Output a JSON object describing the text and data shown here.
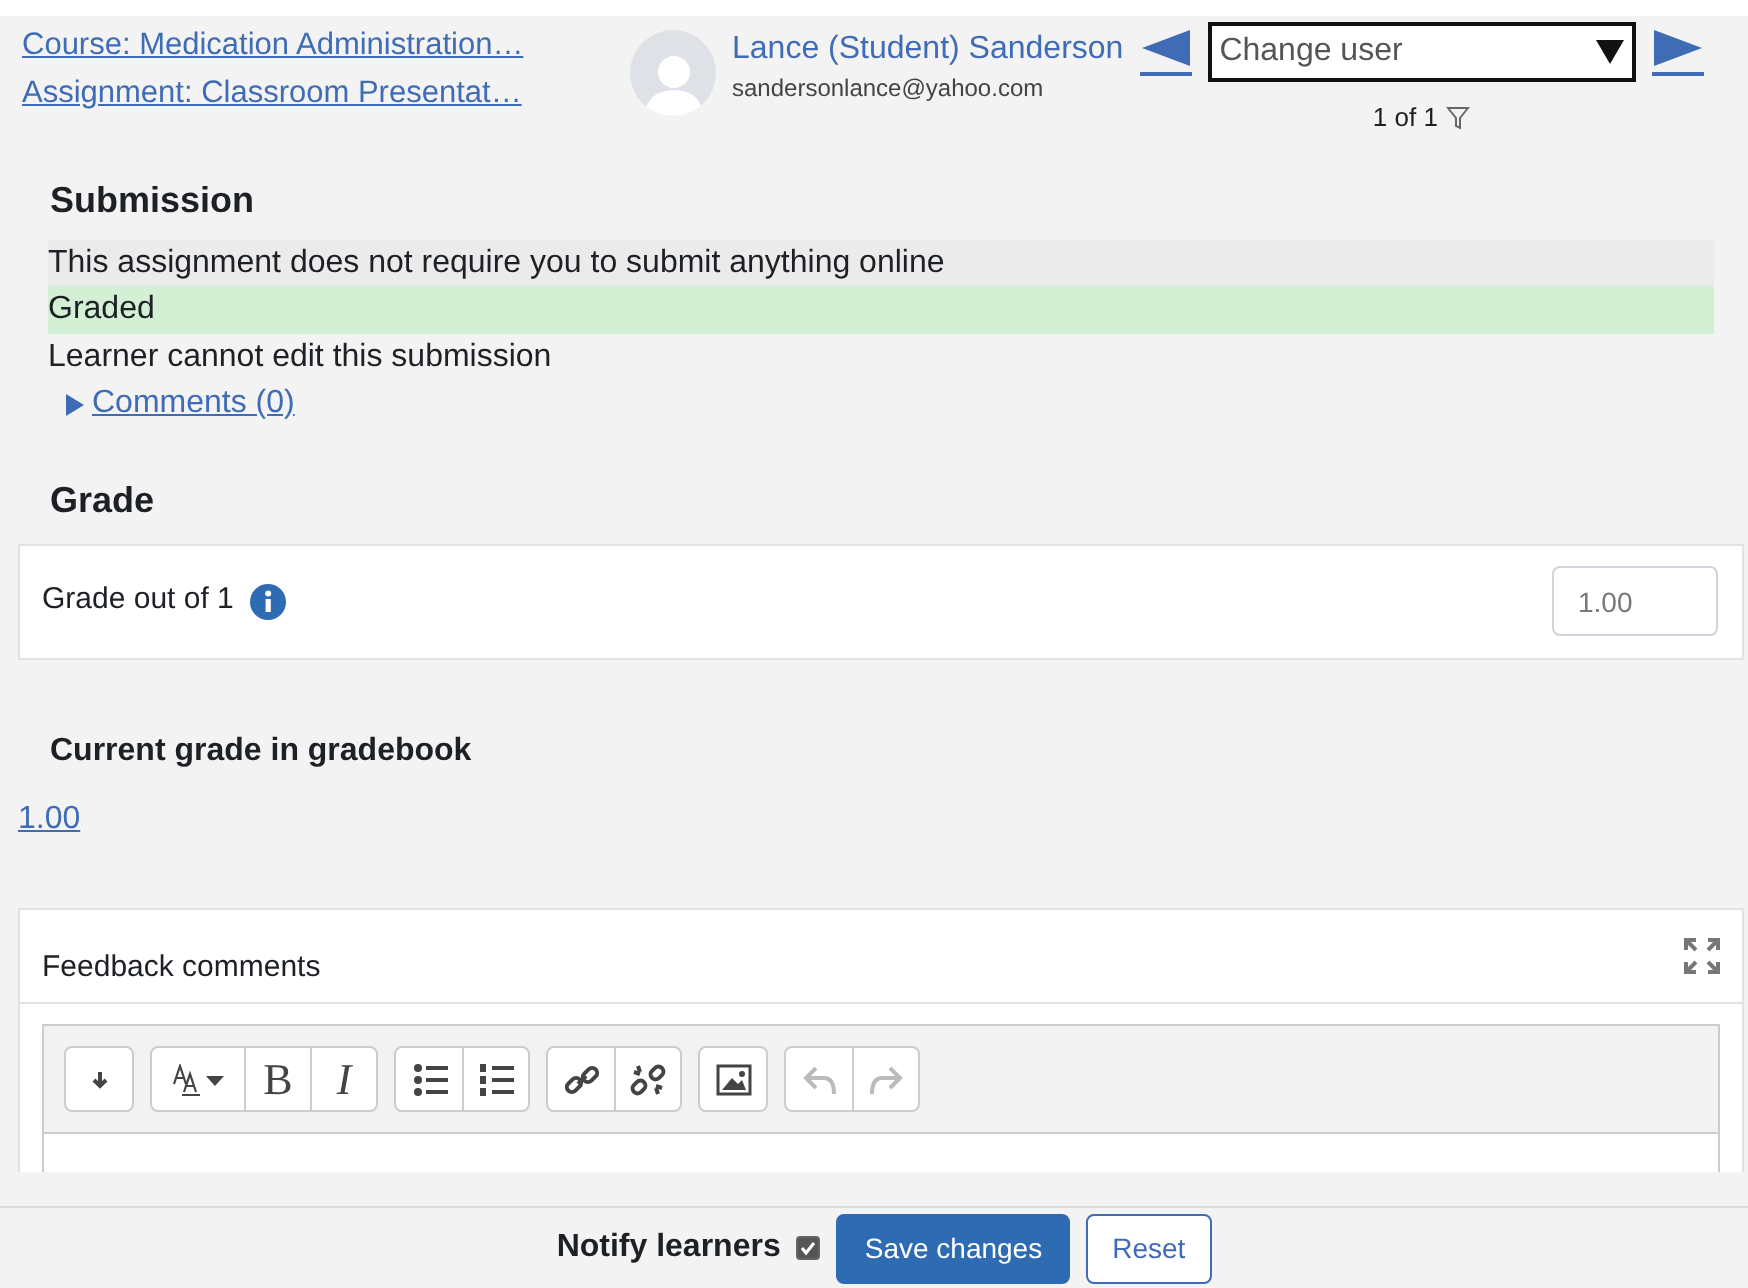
{
  "header": {
    "course_link": "Course: Medication Administration…",
    "assignment_link": "Assignment: Classroom Presentat…",
    "user": {
      "name": "Lance (Student) Sanderson",
      "email": "sandersonlance@yahoo.com"
    },
    "change_user": {
      "placeholder": "Change user"
    },
    "pager": "1 of 1"
  },
  "submission": {
    "title": "Submission",
    "statuses": [
      {
        "text": "This assignment does not require you to submit anything online",
        "kind": "info"
      },
      {
        "text": "Graded",
        "kind": "graded"
      },
      {
        "text": "Learner cannot edit this submission",
        "kind": "plain"
      }
    ],
    "comments": {
      "label": "Comments (0)",
      "expanded": false
    }
  },
  "grade": {
    "title": "Grade",
    "label": "Grade out of 1",
    "value": "1.00"
  },
  "gradebook": {
    "title": "Current grade in gradebook",
    "value": "1.00"
  },
  "feedback": {
    "title": "Feedback comments",
    "toolbar": [
      [
        {
          "kind": "collapse",
          "disabled": false
        }
      ],
      [
        {
          "kind": "style",
          "disabled": false
        },
        {
          "kind": "bold",
          "label": "B",
          "disabled": false
        },
        {
          "kind": "italic",
          "label": "I",
          "disabled": false
        }
      ],
      [
        {
          "kind": "bullets",
          "disabled": false
        },
        {
          "kind": "numbers",
          "disabled": false
        }
      ],
      [
        {
          "kind": "link",
          "disabled": false
        },
        {
          "kind": "unlink",
          "disabled": false
        }
      ],
      [
        {
          "kind": "image",
          "disabled": false
        }
      ],
      [
        {
          "kind": "undo",
          "disabled": true
        },
        {
          "kind": "redo",
          "disabled": true
        }
      ]
    ]
  },
  "footer": {
    "notify": {
      "label": "Notify learners",
      "checked": true
    },
    "buttons": [
      {
        "label": "Save changes",
        "kind": "primary"
      },
      {
        "label": "Reset",
        "kind": "secondary"
      }
    ]
  }
}
